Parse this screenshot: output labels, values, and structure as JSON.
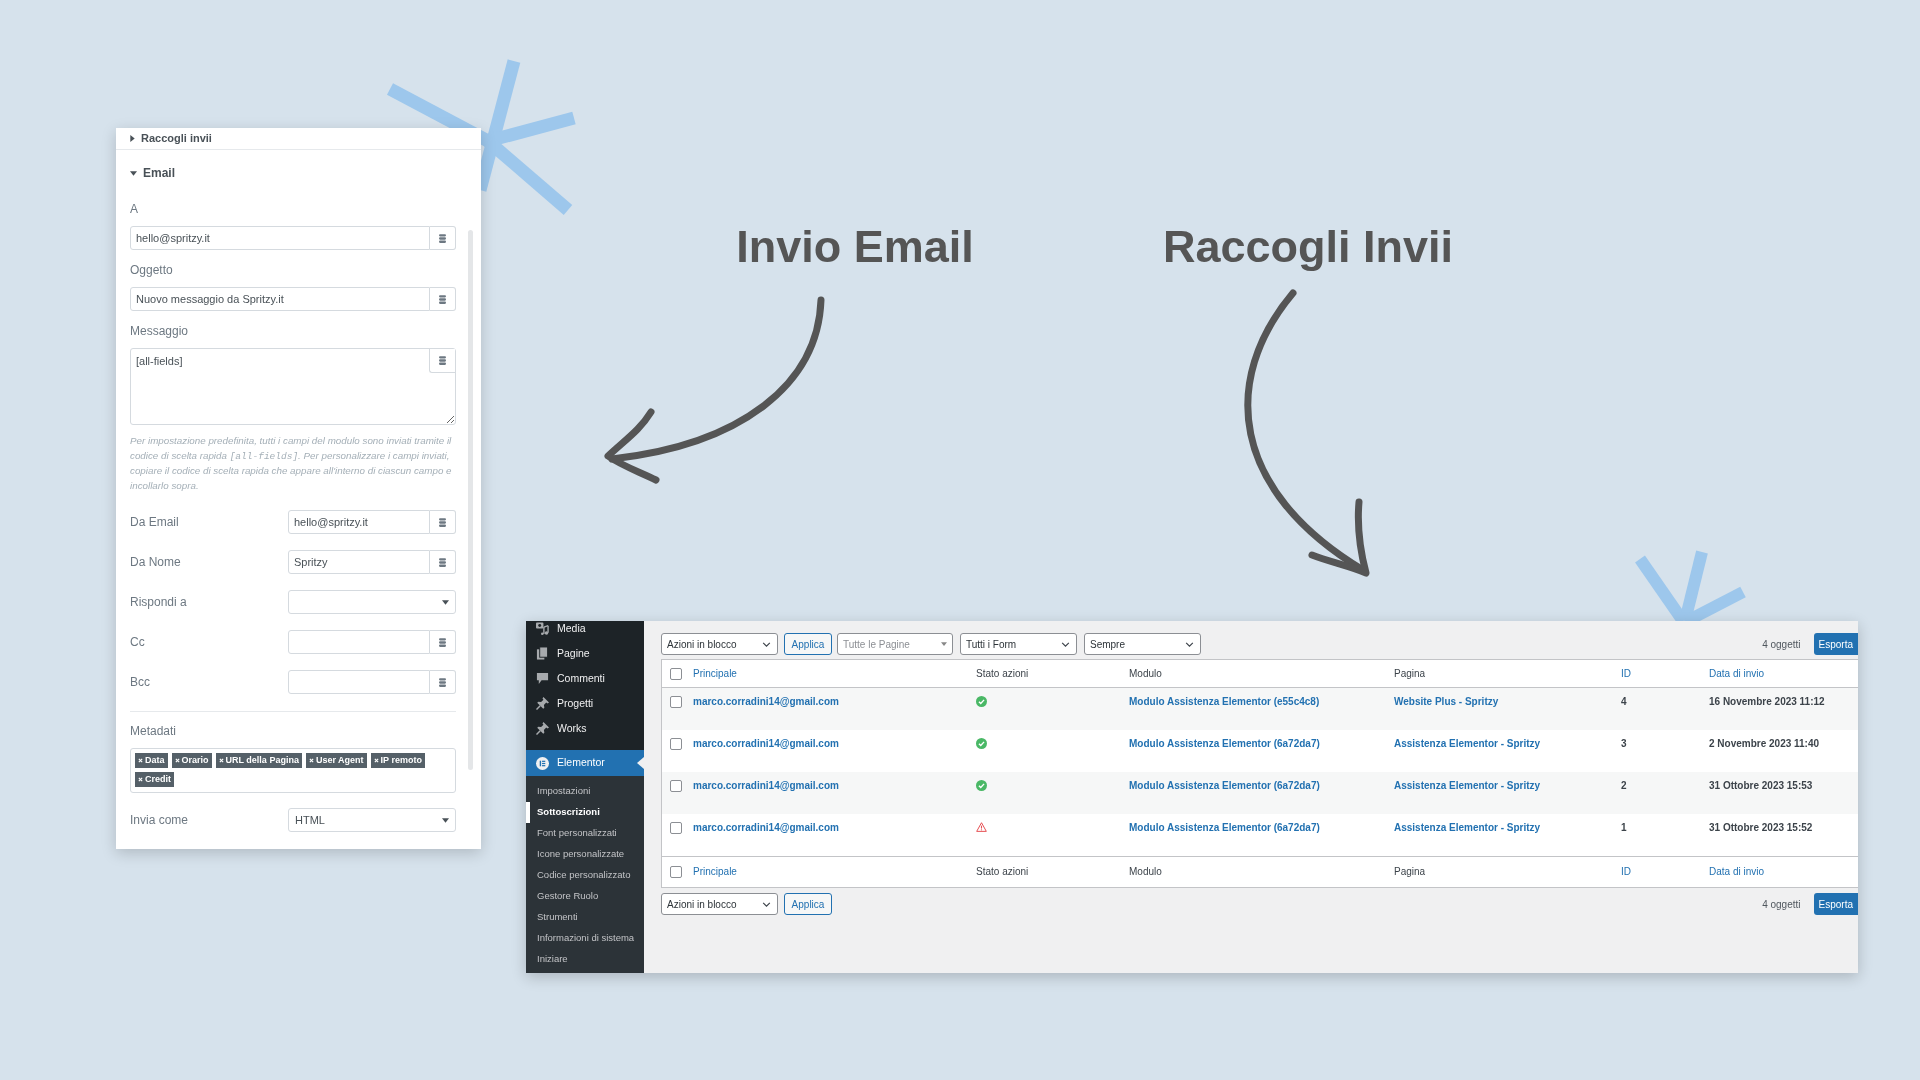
{
  "headings": [
    "Invio Email",
    "Raccogli Invii"
  ],
  "form_panel": {
    "collapsed_section": {
      "label": "Raccogli invii",
      "expanded": false
    },
    "section": {
      "label": "Email",
      "expanded": true
    },
    "stacked_fields": [
      {
        "label": "A",
        "kind": "text",
        "value": "hello@spritzy.it"
      },
      {
        "label": "Oggetto",
        "kind": "text",
        "value": "Nuovo messaggio da Spritzy.it"
      },
      {
        "label": "Messaggio",
        "kind": "textarea",
        "value": "[all-fields]"
      }
    ],
    "help_text": {
      "before": "Per impostazione predefinita, tutti i campi del modulo sono inviati tramite il codice di scelta rapida ",
      "code": "[all-fields]",
      "after": ". Per personalizzare i campi inviati, copiare il codice di scelta rapida che appare all'interno di ciascun campo e incollarlo sopra."
    },
    "inline_fields": [
      {
        "label": "Da Email",
        "kind": "text",
        "value": "hello@spritzy.it"
      },
      {
        "label": "Da Nome",
        "kind": "text",
        "value": "Spritzy"
      },
      {
        "label": "Rispondi a",
        "kind": "select"
      },
      {
        "label": "Cc",
        "kind": "text"
      },
      {
        "label": "Bcc",
        "kind": "text"
      }
    ],
    "metadata": {
      "label": "Metadati",
      "tags": [
        "Data",
        "Orario",
        "URL della Pagina",
        "User Agent",
        "IP remoto",
        "Credit"
      ]
    },
    "send_as": {
      "label": "Invia come",
      "kind": "select",
      "value": "HTML"
    }
  },
  "admin_panel": {
    "sidebar": {
      "menu_groups": [
        [
          {
            "label": "Media",
            "selected": false
          },
          {
            "label": "Pagine",
            "selected": false
          },
          {
            "label": "Commenti",
            "selected": false
          },
          {
            "label": "Progetti",
            "selected": false
          },
          {
            "label": "Works",
            "selected": false
          }
        ],
        [
          {
            "label": "Elementor",
            "selected": true,
            "children": [
              {
                "label": "Impostazioni",
                "selected": false
              },
              {
                "label": "Sottoscrizioni",
                "selected": true
              },
              {
                "label": "Font personalizzati",
                "selected": false
              },
              {
                "label": "Icone personalizzate",
                "selected": false
              },
              {
                "label": "Codice personalizzato",
                "selected": false
              },
              {
                "label": "Gestore Ruolo",
                "selected": false
              },
              {
                "label": "Strumenti",
                "selected": false
              },
              {
                "label": "Informazioni di sistema",
                "selected": false
              },
              {
                "label": "Iniziare",
                "selected": false
              }
            ]
          }
        ]
      ]
    },
    "top_toolbar": {
      "bulk_action": {
        "value": "Azioni in blocco"
      },
      "apply_button": "Applica",
      "filters": [
        {
          "kind": "search_select",
          "placeholder": "Tutte le Pagine"
        },
        {
          "kind": "select",
          "value": "Tutti i Form"
        },
        {
          "kind": "select",
          "value": "Sempre"
        }
      ],
      "count": "4 oggetti",
      "export_button": "Esporta"
    },
    "table": {
      "header": {
        "checked": false,
        "columns": [
          {
            "label": "Principale",
            "sortable": true
          },
          {
            "label": "Stato azioni",
            "sortable": false
          },
          {
            "label": "Modulo",
            "sortable": false
          },
          {
            "label": "Pagina",
            "sortable": false
          },
          {
            "label": "ID",
            "sortable": true
          },
          {
            "label": "Data di invio",
            "sortable": true
          }
        ]
      },
      "rows": [
        {
          "checked": false,
          "main": "marco.corradini14@gmail.com",
          "action_failed": false,
          "form": "Modulo Assistenza Elementor (e55c4c8)",
          "page": "Website Plus - Spritzy",
          "id": "4",
          "date": "16 Novembre 2023 11:12"
        },
        {
          "checked": false,
          "main": "marco.corradini14@gmail.com",
          "action_failed": false,
          "form": "Modulo Assistenza Elementor (6a72da7)",
          "page": "Assistenza Elementor - Spritzy",
          "id": "3",
          "date": "2 Novembre 2023 11:40"
        },
        {
          "checked": false,
          "main": "marco.corradini14@gmail.com",
          "action_failed": false,
          "form": "Modulo Assistenza Elementor (6a72da7)",
          "page": "Assistenza Elementor - Spritzy",
          "id": "2",
          "date": "31 Ottobre 2023 15:53"
        },
        {
          "checked": false,
          "main": "marco.corradini14@gmail.com",
          "action_failed": true,
          "form": "Modulo Assistenza Elementor (6a72da7)",
          "page": "Assistenza Elementor - Spritzy",
          "id": "1",
          "date": "31 Ottobre 2023 15:52"
        }
      ],
      "footer": {
        "checked": false,
        "columns": [
          {
            "label": "Principale",
            "sortable": true
          },
          {
            "label": "Stato azioni",
            "sortable": false
          },
          {
            "label": "Modulo",
            "sortable": false
          },
          {
            "label": "Pagina",
            "sortable": false
          },
          {
            "label": "ID",
            "sortable": true
          },
          {
            "label": "Data di invio",
            "sortable": true
          }
        ]
      }
    },
    "bottom_toolbar": {
      "bulk_action": {
        "value": "Azioni in blocco"
      },
      "apply_button": "Applica",
      "count": "4 oggetti",
      "export_button": "Esporta"
    }
  }
}
